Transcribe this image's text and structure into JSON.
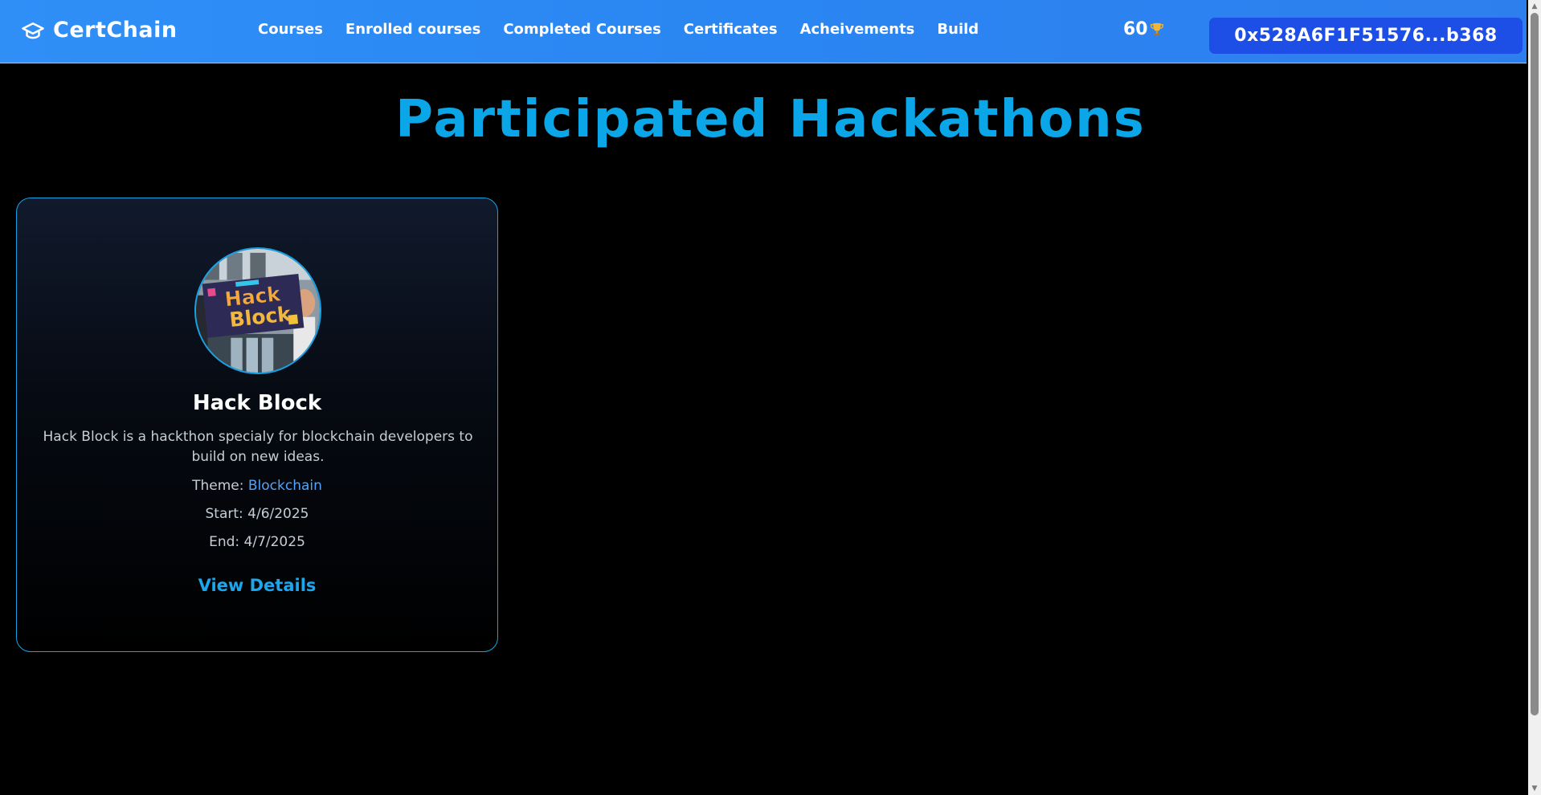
{
  "navbar": {
    "brand": "CertChain",
    "links": [
      "Courses",
      "Enrolled courses",
      "Completed Courses",
      "Certificates",
      "Acheivements",
      "Build"
    ],
    "points": "60",
    "wallet": "0x528A6F1F51576...b368"
  },
  "page": {
    "title": "Participated Hackathons"
  },
  "hackathons": [
    {
      "name": "Hack Block",
      "image_text": [
        "Hack",
        "Block"
      ],
      "description": "Hack Block is a hackthon specialy for blockchain developers to build on new ideas.",
      "theme_label": "Theme:",
      "theme": "Blockchain",
      "start": "Start: 4/6/2025",
      "end": "End: 4/7/2025",
      "link": "View Details"
    }
  ],
  "colors": {
    "navbar": "#2f8ff7",
    "wallet_button": "#1d4ee6",
    "title": "#0aa6e8",
    "card_border": "#16a3e6",
    "theme_value": "#4ea4ff"
  },
  "icons": {
    "brand": "graduation-cap-icon",
    "points": "trophy-icon"
  }
}
